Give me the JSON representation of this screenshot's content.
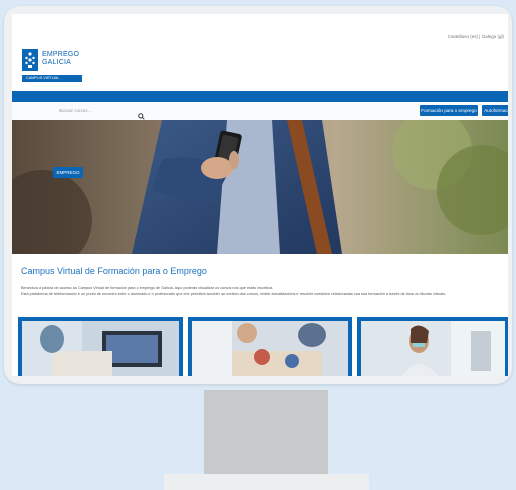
{
  "lang_bar": "Castellano (es) | Galego (gl)",
  "logo": {
    "line1": "EMPREGO",
    "line2": "GALICIA",
    "band": "CAMPUS VIRTUAL"
  },
  "search": {
    "placeholder": "Buscar cursos..."
  },
  "nav_buttons": {
    "formacion": "Formación para o emprego",
    "autoformacion": "Autoformación"
  },
  "hero": {
    "tag": "EMPREGO"
  },
  "main": {
    "title": "Campus Virtual de Formación para o Emprego",
    "intro_line1": "Benvido/a á páxina de acceso ao Campus Virtual de formación para o emprego de Galicia. Aquí poderás visualizar os cursos nos que estás inscrito/a.",
    "intro_line2": "Esta plataforma de teleformación é un punto de encontro entre o alumnado e o profesorado que che permitirá acceder ao contido dos cursos, recibir actualizacións e resolver cuestións relacionadas coa súa formación a través de foros ou titorías virtuais."
  },
  "colors": {
    "brand_blue": "#0c66b6",
    "background": "#dbe9f6"
  }
}
